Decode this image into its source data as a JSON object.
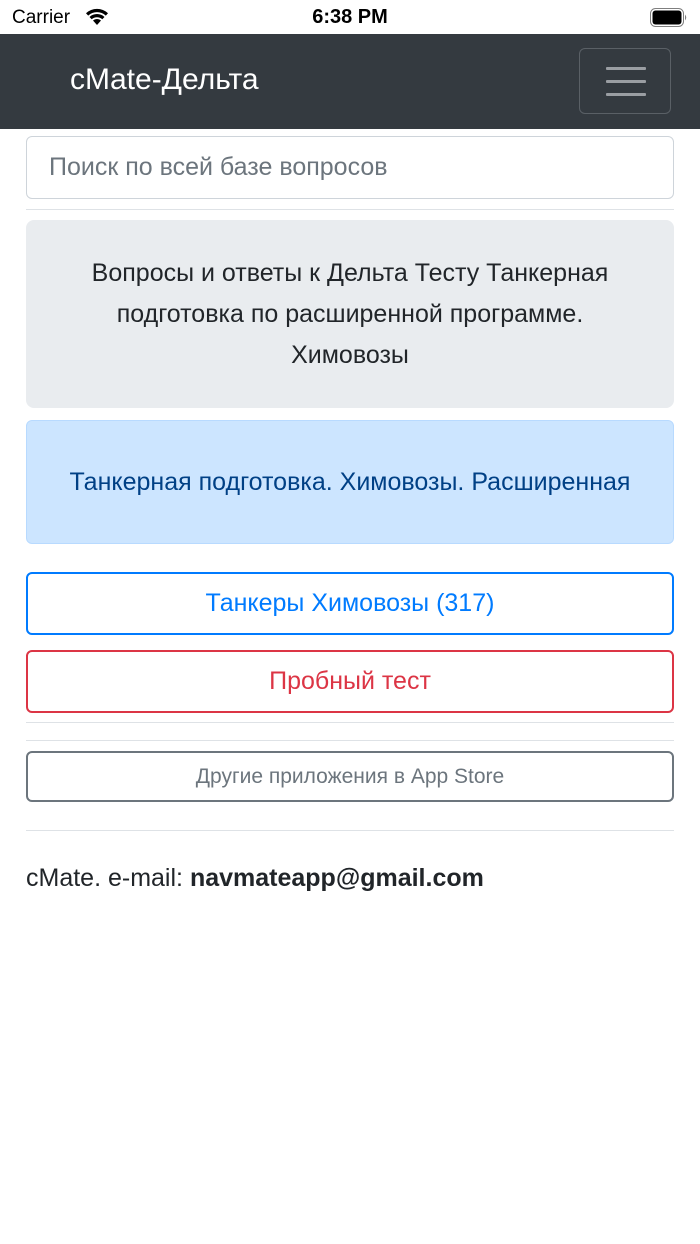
{
  "status_bar": {
    "carrier": "Carrier",
    "time": "6:38 PM",
    "icons": [
      "wifi-icon",
      "battery-icon"
    ]
  },
  "navbar": {
    "brand": "cMate-Дельта",
    "toggler_icon": "hamburger-menu-icon",
    "background": "#343a40"
  },
  "search": {
    "placeholder": "Поиск по всей базе вопросов",
    "value": ""
  },
  "intro": {
    "text": "Вопросы и ответы к Дельта Тесту Танкерная подготовка по расширенной программе. Химовозы"
  },
  "category": {
    "text": "Танкерная подготовка. Химовозы. Расширенная"
  },
  "buttons": {
    "questions": "Танкеры Химовозы (317)",
    "trial_test": "Пробный тест",
    "other_apps": "Другие приложения в App Store"
  },
  "footer": {
    "prefix": "cMate. e-mail: ",
    "email": "navmateapp@gmail.com"
  },
  "colors": {
    "primary": "#007bff",
    "danger": "#dc3545",
    "secondary": "#6c757d",
    "info_bg": "#cce5ff",
    "info_text": "#004085",
    "jumbotron_bg": "#e9ecef"
  }
}
